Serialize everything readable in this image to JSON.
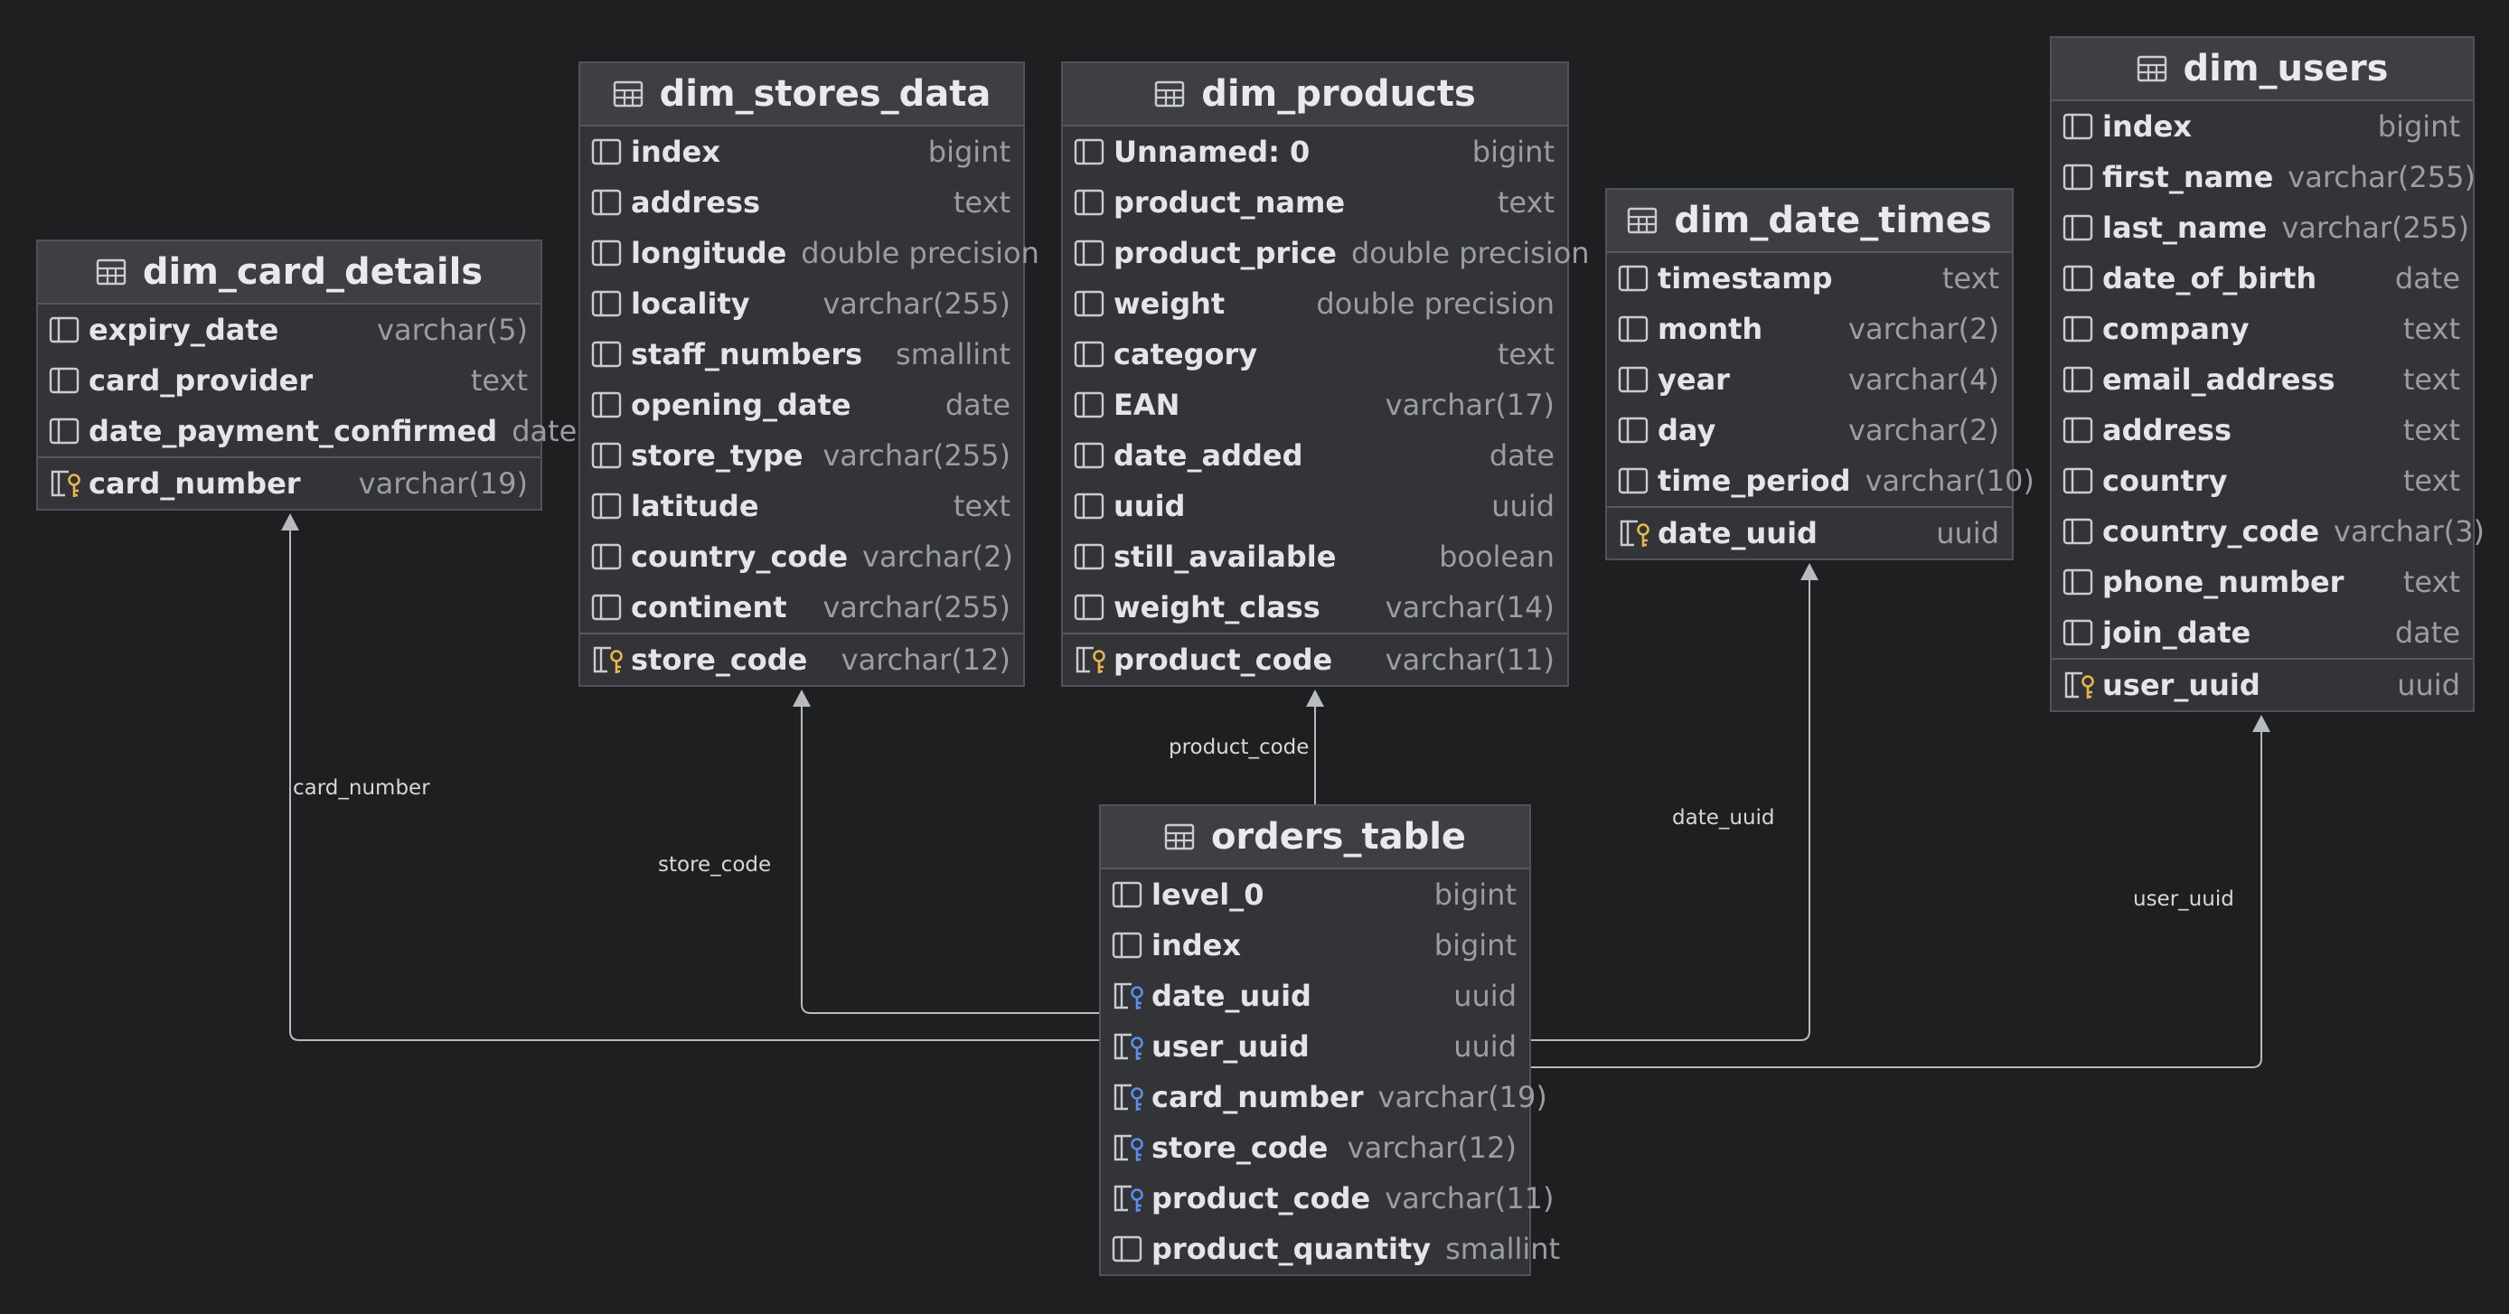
{
  "tables": [
    {
      "name": "dim_card_details",
      "columns": [
        {
          "name": "expiry_date",
          "type": "varchar(5)",
          "icon": "column-icon"
        },
        {
          "name": "card_provider",
          "type": "text",
          "icon": "column-icon"
        },
        {
          "name": "date_payment_confirmed",
          "type": "date",
          "icon": "column-icon"
        }
      ],
      "key": {
        "name": "card_number",
        "type": "varchar(19)",
        "icon": "primary-key-icon"
      }
    },
    {
      "name": "dim_stores_data",
      "columns": [
        {
          "name": "index",
          "type": "bigint",
          "icon": "column-icon"
        },
        {
          "name": "address",
          "type": "text",
          "icon": "column-icon"
        },
        {
          "name": "longitude",
          "type": "double precision",
          "icon": "column-icon"
        },
        {
          "name": "locality",
          "type": "varchar(255)",
          "icon": "column-icon"
        },
        {
          "name": "staff_numbers",
          "type": "smallint",
          "icon": "column-icon"
        },
        {
          "name": "opening_date",
          "type": "date",
          "icon": "column-icon"
        },
        {
          "name": "store_type",
          "type": "varchar(255)",
          "icon": "column-icon"
        },
        {
          "name": "latitude",
          "type": "text",
          "icon": "column-icon"
        },
        {
          "name": "country_code",
          "type": "varchar(2)",
          "icon": "column-icon"
        },
        {
          "name": "continent",
          "type": "varchar(255)",
          "icon": "column-icon"
        }
      ],
      "key": {
        "name": "store_code",
        "type": "varchar(12)",
        "icon": "primary-key-icon"
      }
    },
    {
      "name": "dim_products",
      "columns": [
        {
          "name": "Unnamed: 0",
          "type": "bigint",
          "icon": "column-icon"
        },
        {
          "name": "product_name",
          "type": "text",
          "icon": "column-icon"
        },
        {
          "name": "product_price",
          "type": "double precision",
          "icon": "column-icon"
        },
        {
          "name": "weight",
          "type": "double precision",
          "icon": "column-icon"
        },
        {
          "name": "category",
          "type": "text",
          "icon": "column-icon"
        },
        {
          "name": "EAN",
          "type": "varchar(17)",
          "icon": "column-icon"
        },
        {
          "name": "date_added",
          "type": "date",
          "icon": "column-icon"
        },
        {
          "name": "uuid",
          "type": "uuid",
          "icon": "column-icon"
        },
        {
          "name": "still_available",
          "type": "boolean",
          "icon": "column-icon"
        },
        {
          "name": "weight_class",
          "type": "varchar(14)",
          "icon": "column-icon"
        }
      ],
      "key": {
        "name": "product_code",
        "type": "varchar(11)",
        "icon": "primary-key-icon"
      }
    },
    {
      "name": "dim_date_times",
      "columns": [
        {
          "name": "timestamp",
          "type": "text",
          "icon": "column-icon"
        },
        {
          "name": "month",
          "type": "varchar(2)",
          "icon": "column-icon"
        },
        {
          "name": "year",
          "type": "varchar(4)",
          "icon": "column-icon"
        },
        {
          "name": "day",
          "type": "varchar(2)",
          "icon": "column-icon"
        },
        {
          "name": "time_period",
          "type": "varchar(10)",
          "icon": "column-icon"
        }
      ],
      "key": {
        "name": "date_uuid",
        "type": "uuid",
        "icon": "primary-key-icon"
      }
    },
    {
      "name": "dim_users",
      "columns": [
        {
          "name": "index",
          "type": "bigint",
          "icon": "column-icon"
        },
        {
          "name": "first_name",
          "type": "varchar(255)",
          "icon": "column-icon"
        },
        {
          "name": "last_name",
          "type": "varchar(255)",
          "icon": "column-icon"
        },
        {
          "name": "date_of_birth",
          "type": "date",
          "icon": "column-icon"
        },
        {
          "name": "company",
          "type": "text",
          "icon": "column-icon"
        },
        {
          "name": "email_address",
          "type": "text",
          "icon": "column-icon"
        },
        {
          "name": "address",
          "type": "text",
          "icon": "column-icon"
        },
        {
          "name": "country",
          "type": "text",
          "icon": "column-icon"
        },
        {
          "name": "country_code",
          "type": "varchar(3)",
          "icon": "column-icon"
        },
        {
          "name": "phone_number",
          "type": "text",
          "icon": "column-icon"
        },
        {
          "name": "join_date",
          "type": "date",
          "icon": "column-icon"
        }
      ],
      "key": {
        "name": "user_uuid",
        "type": "uuid",
        "icon": "primary-key-icon"
      }
    },
    {
      "name": "orders_table",
      "columns": [
        {
          "name": "level_0",
          "type": "bigint",
          "icon": "column-icon"
        },
        {
          "name": "index",
          "type": "bigint",
          "icon": "column-icon"
        },
        {
          "name": "date_uuid",
          "type": "uuid",
          "icon": "foreign-key-icon"
        },
        {
          "name": "user_uuid",
          "type": "uuid",
          "icon": "foreign-key-icon"
        },
        {
          "name": "card_number",
          "type": "varchar(19)",
          "icon": "foreign-key-icon"
        },
        {
          "name": "store_code",
          "type": "varchar(12)",
          "icon": "foreign-key-icon"
        },
        {
          "name": "product_code",
          "type": "varchar(11)",
          "icon": "foreign-key-icon"
        },
        {
          "name": "product_quantity",
          "type": "smallint",
          "icon": "column-icon"
        }
      ]
    }
  ],
  "relations": [
    {
      "from_table": "orders_table",
      "to_table": "dim_card_details",
      "label": "card_number"
    },
    {
      "from_table": "orders_table",
      "to_table": "dim_stores_data",
      "label": "store_code"
    },
    {
      "from_table": "orders_table",
      "to_table": "dim_products",
      "label": "product_code"
    },
    {
      "from_table": "orders_table",
      "to_table": "dim_date_times",
      "label": "date_uuid"
    },
    {
      "from_table": "orders_table",
      "to_table": "dim_users",
      "label": "user_uuid"
    }
  ],
  "colors": {
    "background": "#1e1f20",
    "table_body": "#323437",
    "table_header": "#3d3f42",
    "connector": "#b7babe",
    "key_gold": "#e8b64c",
    "key_blue": "#5b8def"
  }
}
